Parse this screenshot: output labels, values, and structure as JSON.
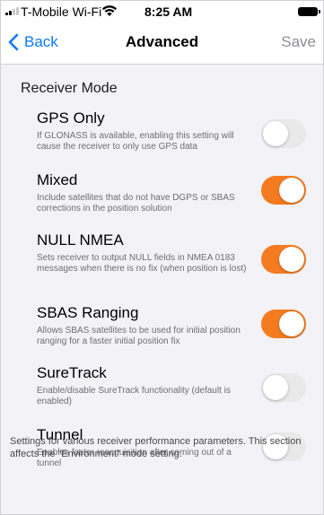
{
  "status_bar": {
    "carrier": "T-Mobile Wi-Fi",
    "time": "8:25 AM",
    "signal_icon": "signal-bars-icon",
    "wifi_icon": "wifi-icon",
    "battery_icon": "battery-icon"
  },
  "nav": {
    "back_label": "Back",
    "title": "Advanced",
    "save_label": "Save"
  },
  "section": {
    "header": "Receiver Mode",
    "items": [
      {
        "title": "GPS Only",
        "description": "If GLONASS is available, enabling this setting will cause the receiver to only use GPS data",
        "enabled": false
      },
      {
        "title": "Mixed",
        "description": "Include satellites that do not have DGPS or SBAS corrections in the position solution",
        "enabled": true
      },
      {
        "title": "NULL NMEA",
        "description": "Sets receiver to output NULL fields in NMEA 0183 messages when there is no fix (when position is lost)",
        "enabled": true
      },
      {
        "title": "SBAS Ranging",
        "description": "Allows SBAS satellites to be used for initial position ranging for a faster initial position fix",
        "enabled": true
      },
      {
        "title": "SureTrack",
        "description": "Enable/disable SureTrack functionality (default is enabled)",
        "enabled": false
      },
      {
        "title": "Tunnel",
        "description": "Enables faster reacquisition after coming out of a tunnel",
        "enabled": false
      }
    ],
    "footer": "Settings for various receiver performance parameters. This section affects the “Environment” mode setting."
  },
  "colors": {
    "accent": "#0a7aff",
    "toggle_on": "#f47b20",
    "toggle_off": "#e9e9ea",
    "background": "#f2f2f7"
  }
}
